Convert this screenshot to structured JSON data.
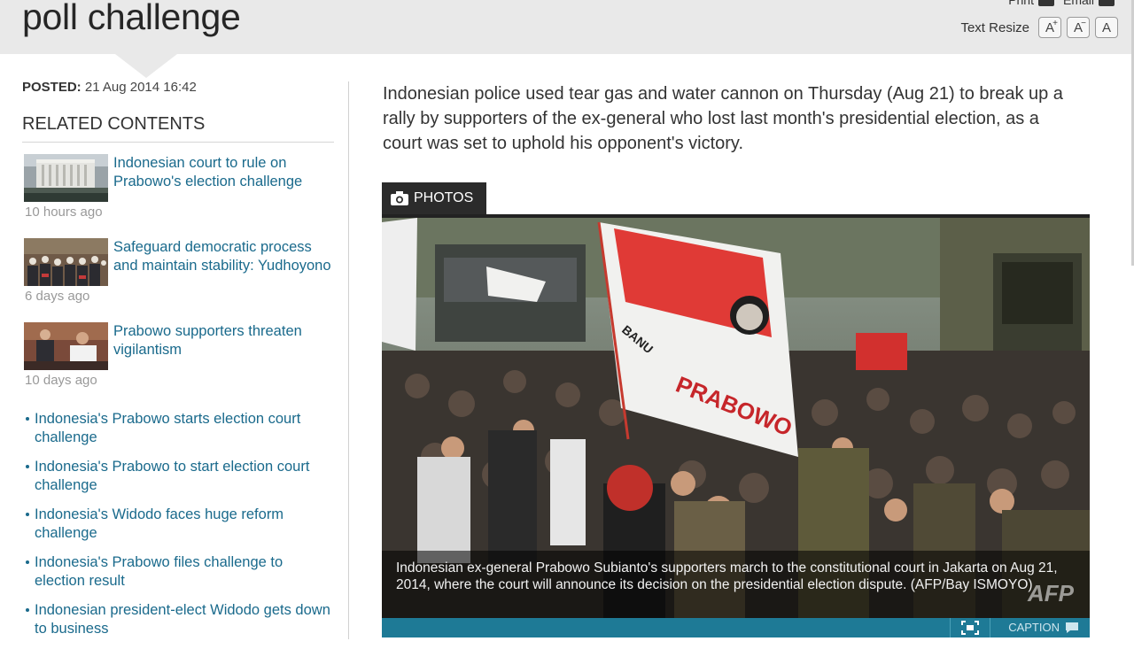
{
  "header": {
    "title": "poll challenge",
    "print_label": "Print",
    "email_label": "Email",
    "text_resize_label": "Text Resize",
    "resize_buttons": [
      "A",
      "A",
      "A"
    ]
  },
  "sidebar": {
    "posted_label": "POSTED:",
    "posted_value": "21 Aug 2014 16:42",
    "related_heading": "RELATED CONTENTS",
    "featured": [
      {
        "title": "Indonesian court to rule on Prabowo's election challenge",
        "ago": "10 hours ago"
      },
      {
        "title": "Safeguard democratic process and maintain stability: Yudhoyono",
        "ago": "6 days ago"
      },
      {
        "title": "Prabowo supporters threaten vigilantism",
        "ago": "10 days ago"
      }
    ],
    "links": [
      "Indonesia's Prabowo starts election court challenge",
      "Indonesia's Prabowo to start election court challenge",
      "Indonesia's Widodo faces huge reform challenge",
      "Indonesia's Prabowo files challenge to election result",
      "Indonesian president-elect Widodo gets down to business"
    ]
  },
  "article": {
    "lead": "Indonesian police used tear gas and water cannon on Thursday (Aug 21) to break up a rally by supporters of the ex-general who lost last month's presidential election, as a court was set to uphold his opponent's victory.",
    "photos_tab": "PHOTOS",
    "photo_caption": "Indonesian ex-general Prabowo Subianto's supporters march to the constitutional court in Jakarta on Aug 21, 2014, where the court will announce its decision on the presidential election dispute. (AFP/Bay ISMOYO)",
    "flag_text_1": "PRABOWO",
    "flag_text_2": "BANU",
    "watermark": "AFP",
    "caption_button": "CAPTION"
  }
}
